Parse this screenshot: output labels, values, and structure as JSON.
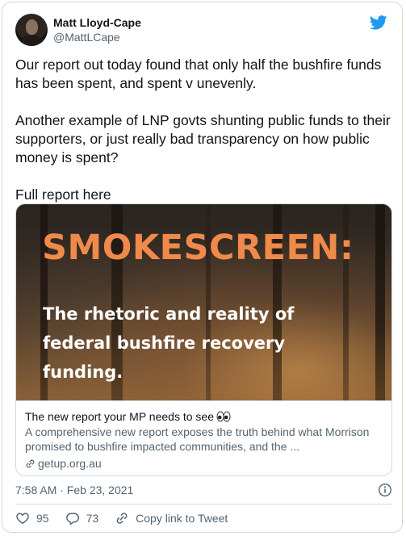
{
  "author": {
    "display_name": "Matt Lloyd-Cape",
    "handle": "@MattLCape"
  },
  "tweet": {
    "text": "Our report out today found that only half the bushfire funds has been spent, and spent v unevenly.\n\nAnother example of LNP govts shunting public funds to their supporters, or just really bad transparency on how public money is spent?\n\nFull report here"
  },
  "link_card": {
    "image_headline": "SMOKESCREEN:",
    "image_subhead": "The rhetoric and reality of federal bushfire recovery funding.",
    "title": "The new report your MP needs to see",
    "title_emoji": "eyes-icon",
    "description": "A comprehensive new report exposes the truth behind what Morrison promised to bushfire impacted communities, and the ...",
    "domain": "getup.org.au"
  },
  "timestamp": "7:58 AM · Feb 23, 2021",
  "actions": {
    "likes": "95",
    "replies": "73",
    "copy_link_label": "Copy link to Tweet"
  },
  "colors": {
    "brand_blue": "#1d9bf0",
    "headline_orange": "#f08a4b",
    "secondary_text": "#536471",
    "border": "#cfd9de"
  }
}
